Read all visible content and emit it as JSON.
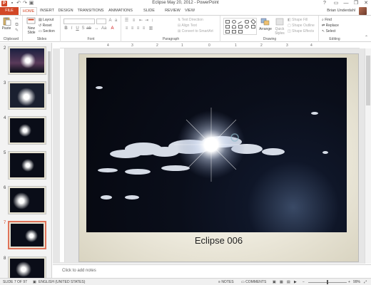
{
  "window": {
    "title": "Eclipse May 20, 2012 - PowerPoint",
    "user": "Brian Underdahl",
    "app_icon": "P",
    "minimize": "—",
    "restore": "❐",
    "close": "✕",
    "help": "?"
  },
  "tabs": [
    "FILE",
    "HOME",
    "INSERT",
    "DESIGN",
    "TRANSITIONS",
    "ANIMATIONS",
    "SLIDE SHOW",
    "REVIEW",
    "VIEW"
  ],
  "ribbon": {
    "clipboard": {
      "label": "Clipboard",
      "paste": "Paste"
    },
    "slides": {
      "label": "Slides",
      "new_slide": "New Slide",
      "layout": "Layout",
      "reset": "Reset",
      "section": "Section"
    },
    "font": {
      "label": "Font"
    },
    "paragraph": {
      "label": "Paragraph",
      "text_direction": "Text Direction",
      "align_text": "Align Text",
      "convert_smartart": "Convert to SmartArt"
    },
    "drawing": {
      "label": "Drawing",
      "arrange": "Arrange",
      "quick_styles": "Quick Styles",
      "shape_fill": "Shape Fill",
      "shape_outline": "Shape Outline",
      "shape_effects": "Shape Effects"
    },
    "editing": {
      "label": "Editing",
      "find": "Find",
      "replace": "Replace",
      "select": "Select"
    }
  },
  "thumbnails": [
    {
      "num": "2"
    },
    {
      "num": "3"
    },
    {
      "num": "4"
    },
    {
      "num": "5"
    },
    {
      "num": "6"
    },
    {
      "num": "7"
    },
    {
      "num": "8"
    }
  ],
  "ruler": {
    "marks": [
      "4",
      "3",
      "2",
      "1",
      "0",
      "1",
      "2",
      "3",
      "4"
    ]
  },
  "slide": {
    "caption": "Eclipse 006"
  },
  "notes": {
    "placeholder": "Click to add notes"
  },
  "status": {
    "slide_info": "SLIDE 7 OF 97",
    "language": "ENGLISH (UNITED STATES)",
    "notes": "NOTES",
    "comments": "COMMENTS",
    "zoom": "99%"
  },
  "colors": {
    "accent": "#d24726",
    "selected_thumb": "#e0735a"
  }
}
